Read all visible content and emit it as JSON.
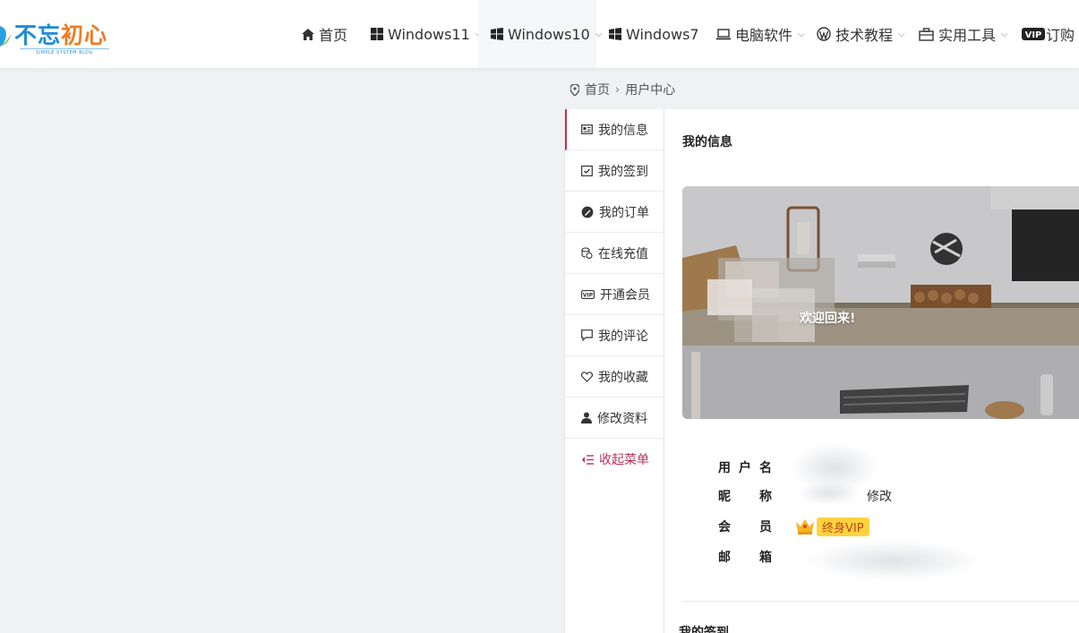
{
  "logo": {
    "text_a": "不忘",
    "text_b": "初心",
    "sub": "SIMPLE SYSTEM BLOG"
  },
  "nav": [
    {
      "label": "首页",
      "icon": "home-icon",
      "dropdown": false
    },
    {
      "label": "Windows11",
      "icon": "windows-icon",
      "dropdown": true
    },
    {
      "label": "Windows10",
      "icon": "windows-icon",
      "dropdown": true,
      "active": true
    },
    {
      "label": "Windows7",
      "icon": "windows-icon",
      "dropdown": false
    },
    {
      "label": "电脑软件",
      "icon": "laptop-icon",
      "dropdown": true
    },
    {
      "label": "技术教程",
      "icon": "wordpress-icon",
      "dropdown": true
    },
    {
      "label": "实用工具",
      "icon": "briefcase-icon",
      "dropdown": true
    },
    {
      "label": "订购",
      "icon": "vip-icon",
      "dropdown": false
    }
  ],
  "breadcrumb": {
    "home": "首页",
    "current": "用户中心"
  },
  "menu": [
    {
      "label": "我的信息",
      "icon": "id-card-icon",
      "active": true
    },
    {
      "label": "我的签到",
      "icon": "calendar-check-icon"
    },
    {
      "label": "我的订单",
      "icon": "order-icon"
    },
    {
      "label": "在线充值",
      "icon": "coins-icon"
    },
    {
      "label": "开通会员",
      "icon": "vip-icon"
    },
    {
      "label": "我的评论",
      "icon": "comment-icon"
    },
    {
      "label": "我的收藏",
      "icon": "heart-icon"
    },
    {
      "label": "修改资料",
      "icon": "user-icon"
    },
    {
      "label": "收起菜单",
      "icon": "collapse-icon"
    }
  ],
  "panel": {
    "title": "我的信息",
    "welcome": "欢迎回来!",
    "labels": {
      "username": "用户名",
      "nickname": "昵称",
      "membership": "会员",
      "email": "邮箱"
    },
    "edit": "修改",
    "vip": "终身VIP",
    "next_section": "我的签到"
  },
  "colors": {
    "accent": "#c0315a",
    "vip": "#ffd23e",
    "brand_blue": "#1e8bd8",
    "brand_orange": "#f07a21"
  }
}
